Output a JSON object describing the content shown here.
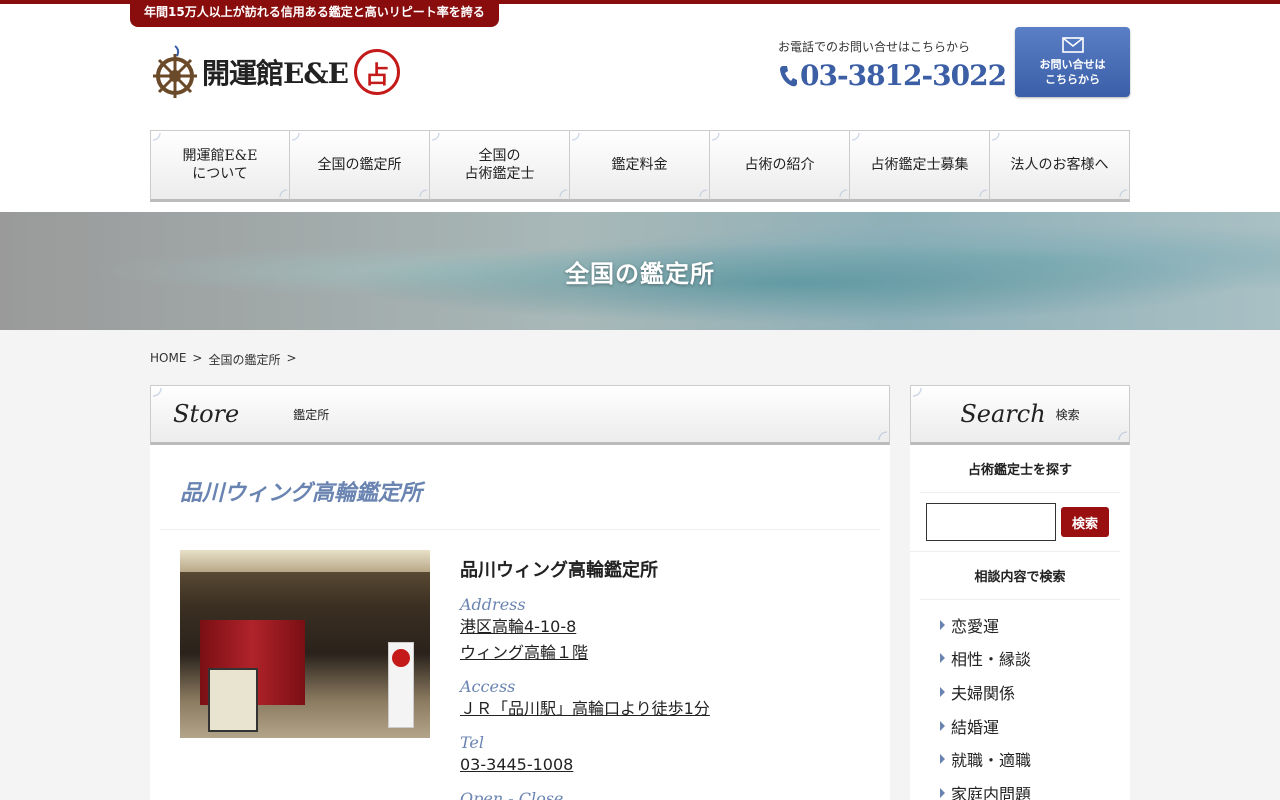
{
  "tagline": "年間15万人以上が訪れる信用ある鑑定と高いリピート率を誇る",
  "logo": {
    "text": "開運館E&E",
    "seal": "占"
  },
  "contact": {
    "lead": "お電話でのお問い合せはこちらから",
    "phone": "03-3812-3022",
    "mail_button_line1": "お問い合せは",
    "mail_button_line2": "こちらから"
  },
  "nav": [
    {
      "line1": "開運館E&E",
      "line2": "について"
    },
    {
      "line1": "全国の鑑定所",
      "line2": ""
    },
    {
      "line1": "全国の",
      "line2": "占術鑑定士"
    },
    {
      "line1": "鑑定料金",
      "line2": ""
    },
    {
      "line1": "占術の紹介",
      "line2": ""
    },
    {
      "line1": "占術鑑定士募集",
      "line2": ""
    },
    {
      "line1": "法人のお客様へ",
      "line2": ""
    }
  ],
  "hero": {
    "title": "全国の鑑定所"
  },
  "breadcrumb": {
    "home": "HOME",
    "sep1": ">",
    "current": "全国の鑑定所",
    "sep2": ">"
  },
  "main": {
    "head_script": "Store",
    "head_sub": "鑑定所",
    "store_title": "品川ウィング高輪鑑定所",
    "info": {
      "name": "品川ウィング高輪鑑定所",
      "address_label": "Address",
      "address_line1": "港区高輪4-10-8",
      "address_line2": "ウィング高輪１階",
      "access_label": "Access",
      "access_value": "ＪＲ「品川駅」高輪口より徒歩1分",
      "tel_label": "Tel",
      "tel_value": "03-3445-1008",
      "hours_label": "Open - Close"
    }
  },
  "sidebar": {
    "head_script": "Search",
    "head_sub": "検索",
    "find_label": "占術鑑定士を探す",
    "search_button": "検索",
    "search_value": "",
    "category_label": "相談内容で検索",
    "categories": [
      "恋愛運",
      "相性・縁談",
      "夫婦関係",
      "結婚運",
      "就職・適職",
      "家庭内問題"
    ]
  },
  "colors": {
    "brand_red": "#8a0d0d",
    "accent_blue": "#3b5ea5",
    "label_blue": "#6a84b2"
  }
}
